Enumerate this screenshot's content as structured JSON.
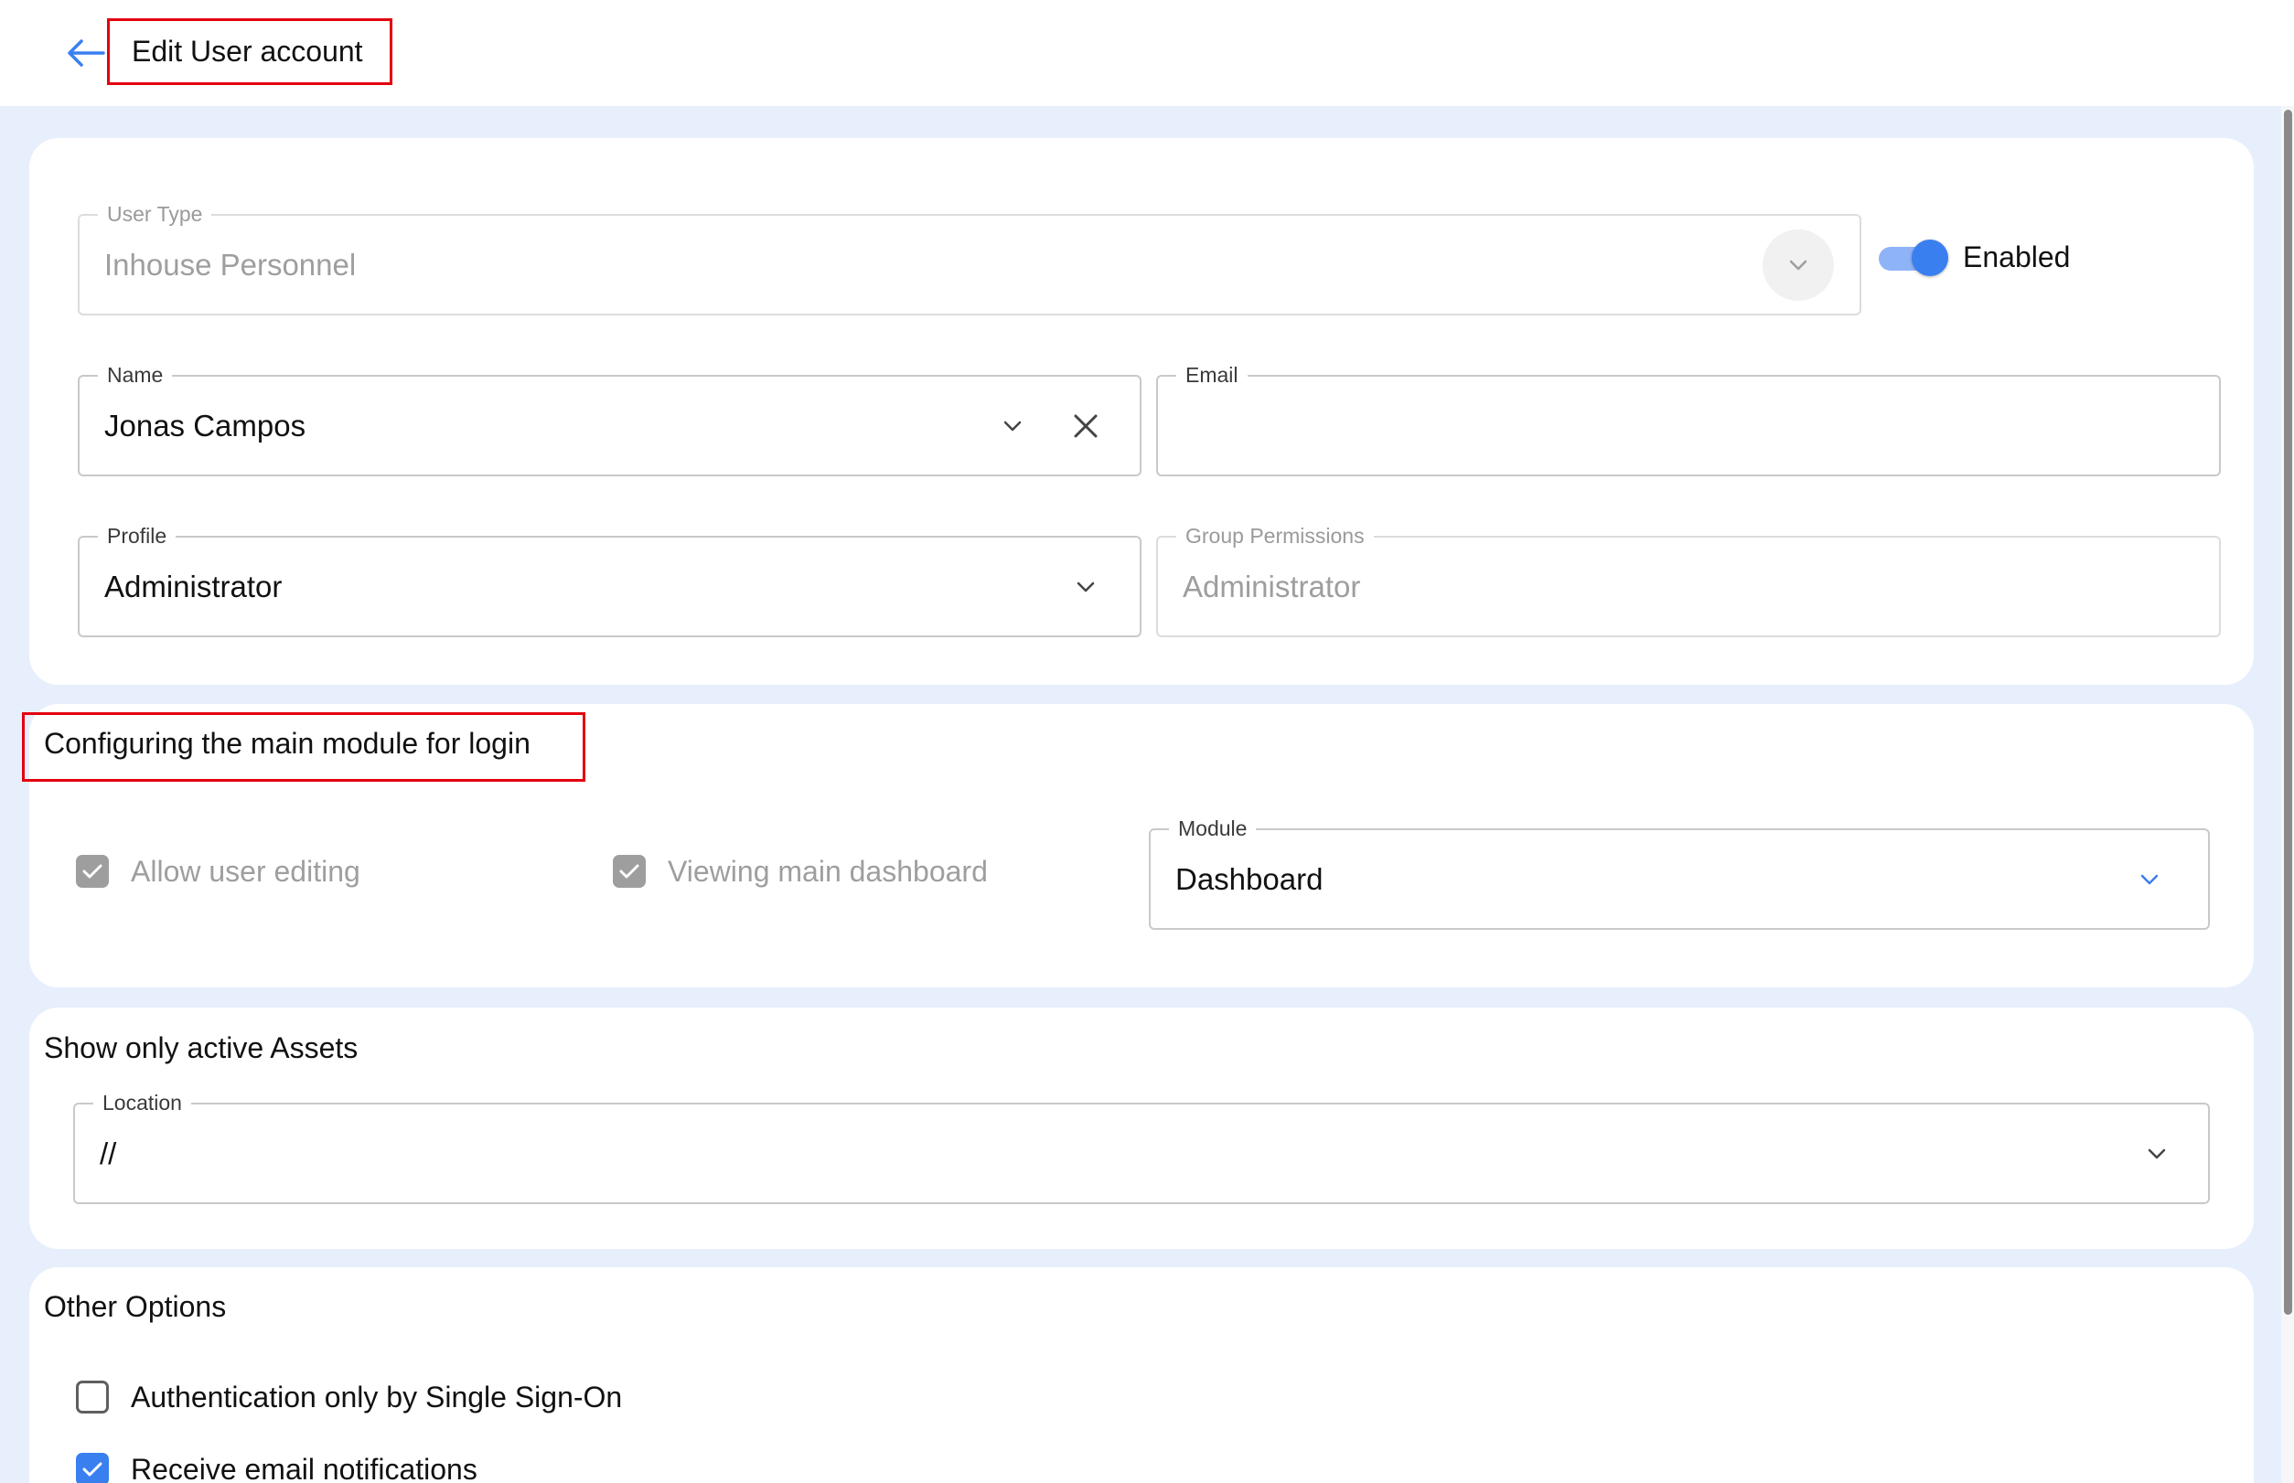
{
  "header": {
    "title": "Edit User account"
  },
  "user_section": {
    "user_type": {
      "label": "User Type",
      "value": "Inhouse Personnel"
    },
    "status_toggle": {
      "label": "Enabled",
      "on": true
    },
    "name": {
      "label": "Name",
      "value": "Jonas Campos"
    },
    "email": {
      "label": "Email",
      "value": ""
    },
    "profile": {
      "label": "Profile",
      "value": "Administrator"
    },
    "group_permissions": {
      "label": "Group Permissions",
      "value": "Administrator"
    }
  },
  "login_module_section": {
    "title": "Configuring the main module for login",
    "allow_user_editing": {
      "label": "Allow user editing",
      "checked": true
    },
    "viewing_main_dashboard": {
      "label": "Viewing main dashboard",
      "checked": true
    },
    "module": {
      "label": "Module",
      "value": "Dashboard"
    }
  },
  "assets_section": {
    "title": "Show only active Assets",
    "location": {
      "label": "Location",
      "value": "//"
    }
  },
  "other_options": {
    "title": "Other Options",
    "sso_only": {
      "label": "Authentication only by Single Sign-On",
      "checked": false
    },
    "email_notifications": {
      "label": "Receive email notifications",
      "checked": true
    }
  },
  "colors": {
    "accent": "#3a7ff0",
    "highlight_border": "#e3000f",
    "page_background": "#e7effd"
  },
  "icons": {
    "back": "arrow-left-icon",
    "dropdown": "chevron-down-icon",
    "clear": "close-icon",
    "check": "check-icon"
  }
}
